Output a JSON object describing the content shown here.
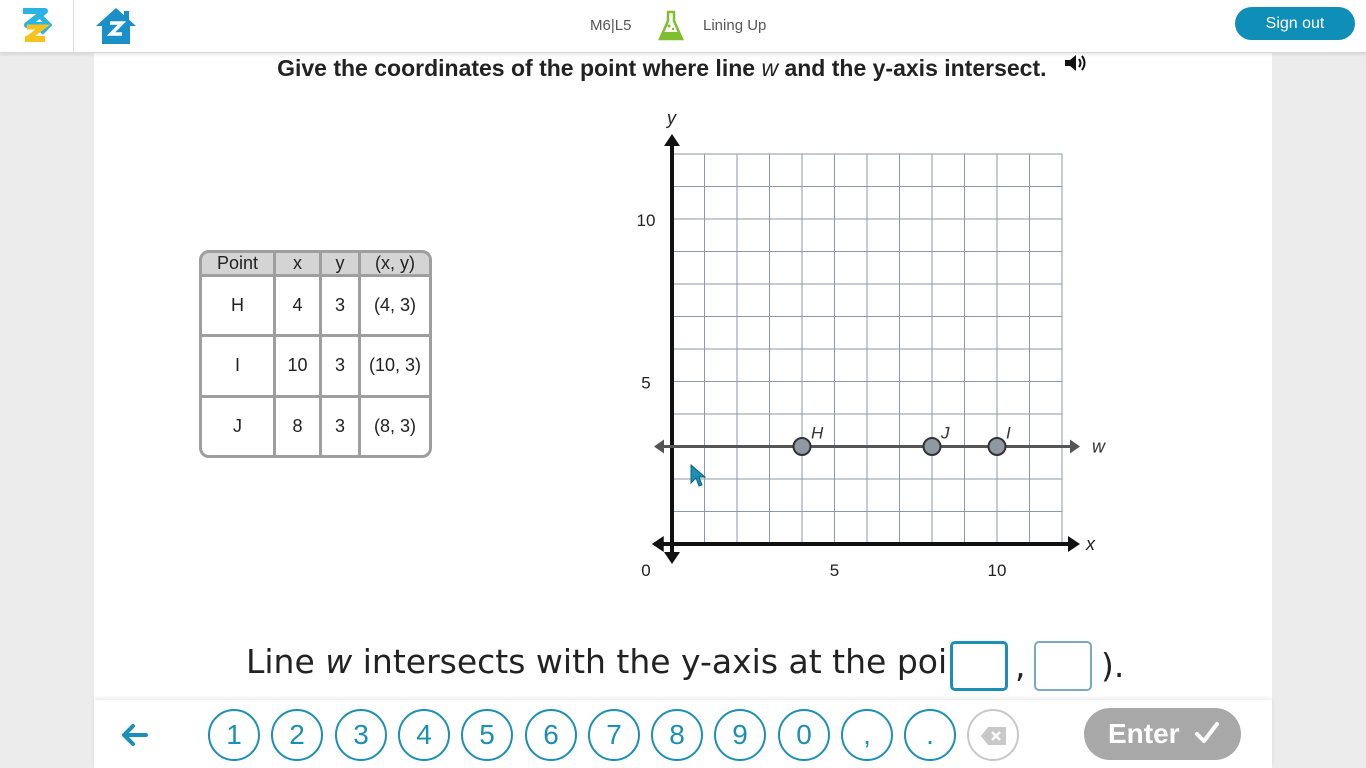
{
  "header": {
    "lesson_code": "M6|L5",
    "lesson_title": "Lining Up",
    "sign_out_label": "Sign out",
    "logo_icon": "zearn-logo-icon",
    "home_icon": "home-icon",
    "activity_icon": "flask-icon",
    "accent_color": "#0f8fb8"
  },
  "question": {
    "text_before": "Give the coordinates of the point where line ",
    "variable": "w",
    "text_after": " and the y-axis intersect.",
    "audio_icon": "speaker-icon"
  },
  "table": {
    "headers": [
      "Point",
      "x",
      "y",
      "(x, y)"
    ],
    "rows": [
      [
        "H",
        "4",
        "3",
        "(4, 3)"
      ],
      [
        "I",
        "10",
        "3",
        "(10, 3)"
      ],
      [
        "J",
        "8",
        "3",
        "(8, 3)"
      ]
    ]
  },
  "graph": {
    "axis_x_label": "x",
    "axis_y_label": "y",
    "line_label": "w",
    "x_ticks": [
      "0",
      "5",
      "10"
    ],
    "y_ticks": [
      "5",
      "10"
    ],
    "xlim": [
      0,
      12
    ],
    "ylim": [
      0,
      12
    ],
    "line_y": 3,
    "points": [
      {
        "label": "H",
        "x": 4,
        "y": 3
      },
      {
        "label": "J",
        "x": 8,
        "y": 3
      },
      {
        "label": "I",
        "x": 10,
        "y": 3
      }
    ]
  },
  "answer": {
    "text_before": "Line ",
    "variable": "w",
    "text_after": " intersects with the y-axis at the point (",
    "comma": ",",
    "close": ").",
    "x_value": "",
    "y_value": ""
  },
  "keypad": {
    "back_icon": "arrow-left-icon",
    "keys": [
      "1",
      "2",
      "3",
      "4",
      "5",
      "6",
      "7",
      "8",
      "9",
      "0",
      ",",
      "."
    ],
    "delete_icon": "backspace-icon",
    "enter_label": "Enter",
    "enter_icon": "checkmark-icon"
  }
}
